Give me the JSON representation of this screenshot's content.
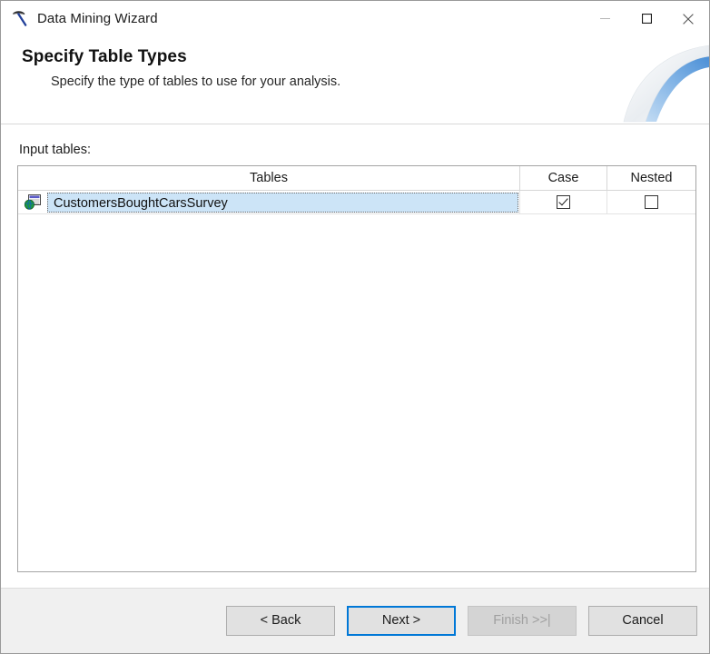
{
  "window": {
    "title": "Data Mining Wizard",
    "icon": "pickaxe-icon",
    "controls": {
      "minimize_label": "—",
      "maximize_label": "☐",
      "close_label": "✕"
    }
  },
  "banner": {
    "title": "Specify Table Types",
    "subtitle": "Specify the type of tables to use for your analysis."
  },
  "main": {
    "input_tables_label": "Input tables:",
    "listview": {
      "columns": [
        {
          "key": "tables",
          "label": "Tables"
        },
        {
          "key": "case",
          "label": "Case"
        },
        {
          "key": "nested",
          "label": "Nested"
        }
      ],
      "rows": [
        {
          "icon": "table-globe-icon",
          "name": "CustomersBoughtCarsSurvey",
          "case_checked": true,
          "nested_checked": false,
          "selected": true
        }
      ]
    }
  },
  "footer": {
    "buttons": [
      {
        "name": "back-button",
        "label": "< Back",
        "state": "enabled"
      },
      {
        "name": "next-button",
        "label": "Next >",
        "state": "default"
      },
      {
        "name": "finish-button",
        "label": "Finish >>|",
        "state": "disabled"
      },
      {
        "name": "cancel-button",
        "label": "Cancel",
        "state": "enabled"
      }
    ]
  },
  "colors": {
    "accent": "#0078d7",
    "selection": "#cce4f7",
    "footer_bg": "#f0f0f0",
    "window_bg": "#ffffff"
  }
}
